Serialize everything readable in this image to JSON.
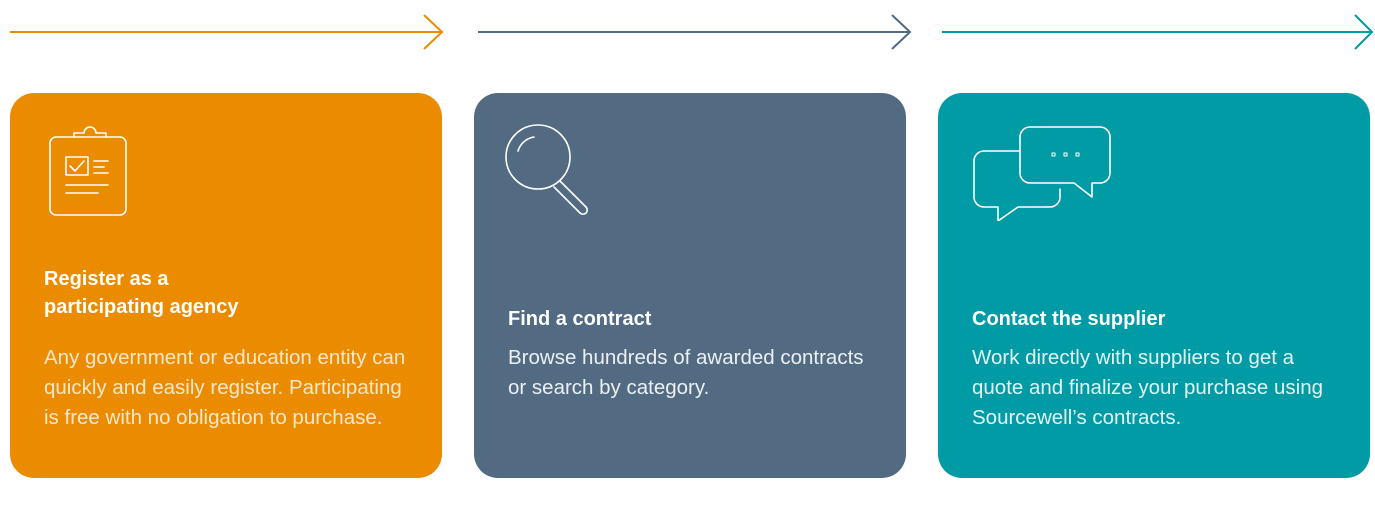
{
  "colors": {
    "orange": "#eb8c00",
    "slate": "#526b82",
    "teal": "#009ba5",
    "orange_text": "#fbe7cc",
    "slate_text": "#ecf0f4",
    "teal_text": "#e2f5f6"
  },
  "steps": [
    {
      "icon": "clipboard-checklist-icon",
      "title_line1": "Register as a",
      "title_line2": "participating agency",
      "description": "Any government or education entity can quickly and easily register. Participating is free with no obligation to purchase."
    },
    {
      "icon": "magnifying-glass-icon",
      "title": "Find a contract",
      "description": "Browse hundreds of awarded contracts or search by category."
    },
    {
      "icon": "chat-bubbles-icon",
      "title": "Contact the supplier",
      "description": "Work directly with suppliers to get a quote and finalize your purchase using Sourcewell’s contracts."
    }
  ]
}
